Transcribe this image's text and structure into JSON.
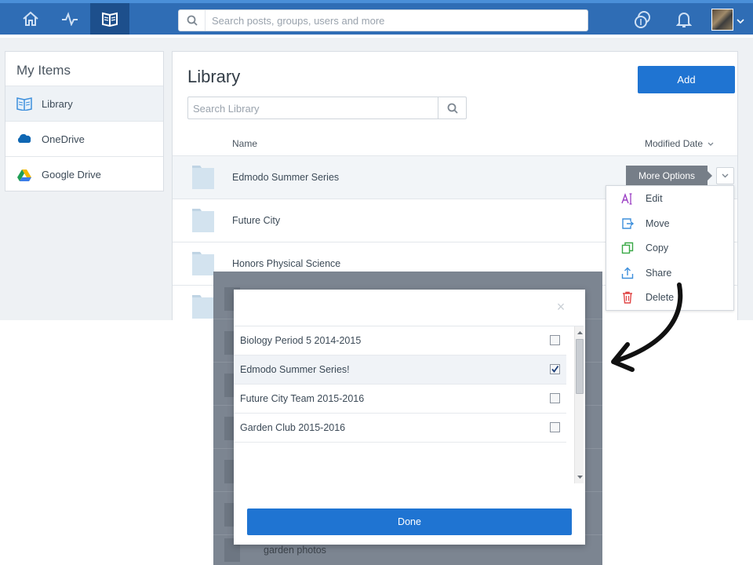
{
  "topbar": {
    "search_placeholder": "Search posts, groups, users and more",
    "nav": [
      "home-icon",
      "activity-icon",
      "library-icon"
    ],
    "right_icons": [
      "coins-icon",
      "bell-icon"
    ],
    "accent": "#2f6db5"
  },
  "sidebar": {
    "title": "My Items",
    "items": [
      {
        "label": "Library",
        "icon": "library-icon"
      },
      {
        "label": "OneDrive",
        "icon": "onedrive-icon"
      },
      {
        "label": "Google Drive",
        "icon": "google-drive-icon"
      }
    ]
  },
  "main": {
    "title": "Library",
    "add_label": "Add",
    "search_placeholder": "Search Library",
    "col_name": "Name",
    "col_modified": "Modified Date",
    "rows": [
      {
        "name": "Edmodo Summer Series"
      },
      {
        "name": "Future City"
      },
      {
        "name": "Honors Physical Science"
      }
    ],
    "tooltip": "More Options"
  },
  "menu": {
    "items": [
      {
        "label": "Edit",
        "icon": "edit-icon",
        "color": "#9b3fc4"
      },
      {
        "label": "Move",
        "icon": "move-icon",
        "color": "#3d8fdc"
      },
      {
        "label": "Copy",
        "icon": "copy-icon",
        "color": "#39a845"
      },
      {
        "label": "Share",
        "icon": "share-icon",
        "color": "#3d8fdc"
      },
      {
        "label": "Delete",
        "icon": "trash-icon",
        "color": "#e04545"
      }
    ]
  },
  "modal": {
    "close": "×",
    "groups": [
      {
        "name": "Biology Period 5 2014-2015",
        "checked": false
      },
      {
        "name": "Edmodo Summer Series!",
        "checked": true
      },
      {
        "name": "Future City Team 2015-2016",
        "checked": false
      },
      {
        "name": "Garden Club 2015-2016",
        "checked": false
      }
    ],
    "done_label": "Done",
    "background_row_text": "garden photos"
  }
}
